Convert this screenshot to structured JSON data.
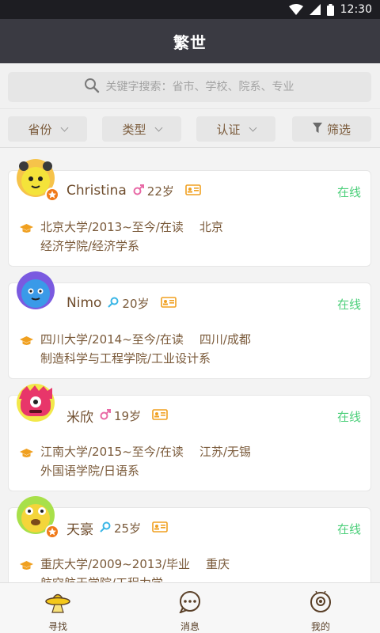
{
  "status_bar": {
    "time": "12:30"
  },
  "header": {
    "title": "繁世"
  },
  "search": {
    "placeholder": "关键字搜索：省市、学校、院系、专业"
  },
  "filters": [
    {
      "label": "省份"
    },
    {
      "label": "类型"
    },
    {
      "label": "认证"
    },
    {
      "label": "筛选"
    }
  ],
  "users": [
    {
      "name": "Christina",
      "gender": "male",
      "age": "22岁",
      "status": "在线",
      "school_line": "北京大学/2013~至今/在读",
      "location": "北京",
      "dept_line": "经济学院/经济学系"
    },
    {
      "name": "Nimo",
      "gender": "female",
      "age": "20岁",
      "status": "在线",
      "school_line": "四川大学/2014~至今/在读",
      "location": "四川/成都",
      "dept_line": "制造科学与工程学院/工业设计系"
    },
    {
      "name": "米欣",
      "gender": "male",
      "age": "19岁",
      "status": "在线",
      "school_line": "江南大学/2015~至今/在读",
      "location": "江苏/无锡",
      "dept_line": "外国语学院/日语系"
    },
    {
      "name": "天豪",
      "gender": "female",
      "age": "25岁",
      "status": "在线",
      "school_line": "重庆大学/2009~2013/毕业",
      "location": "重庆",
      "dept_line": "航空航天学院/工程力学"
    }
  ],
  "tabs": [
    {
      "label": "寻找"
    },
    {
      "label": "消息"
    },
    {
      "label": "我的"
    }
  ],
  "colors": {
    "online": "#4ccf7a",
    "male": "#e86aa6",
    "female": "#3ab6e6",
    "title_bar": "#3a3a42",
    "accent": "#f0a020"
  }
}
